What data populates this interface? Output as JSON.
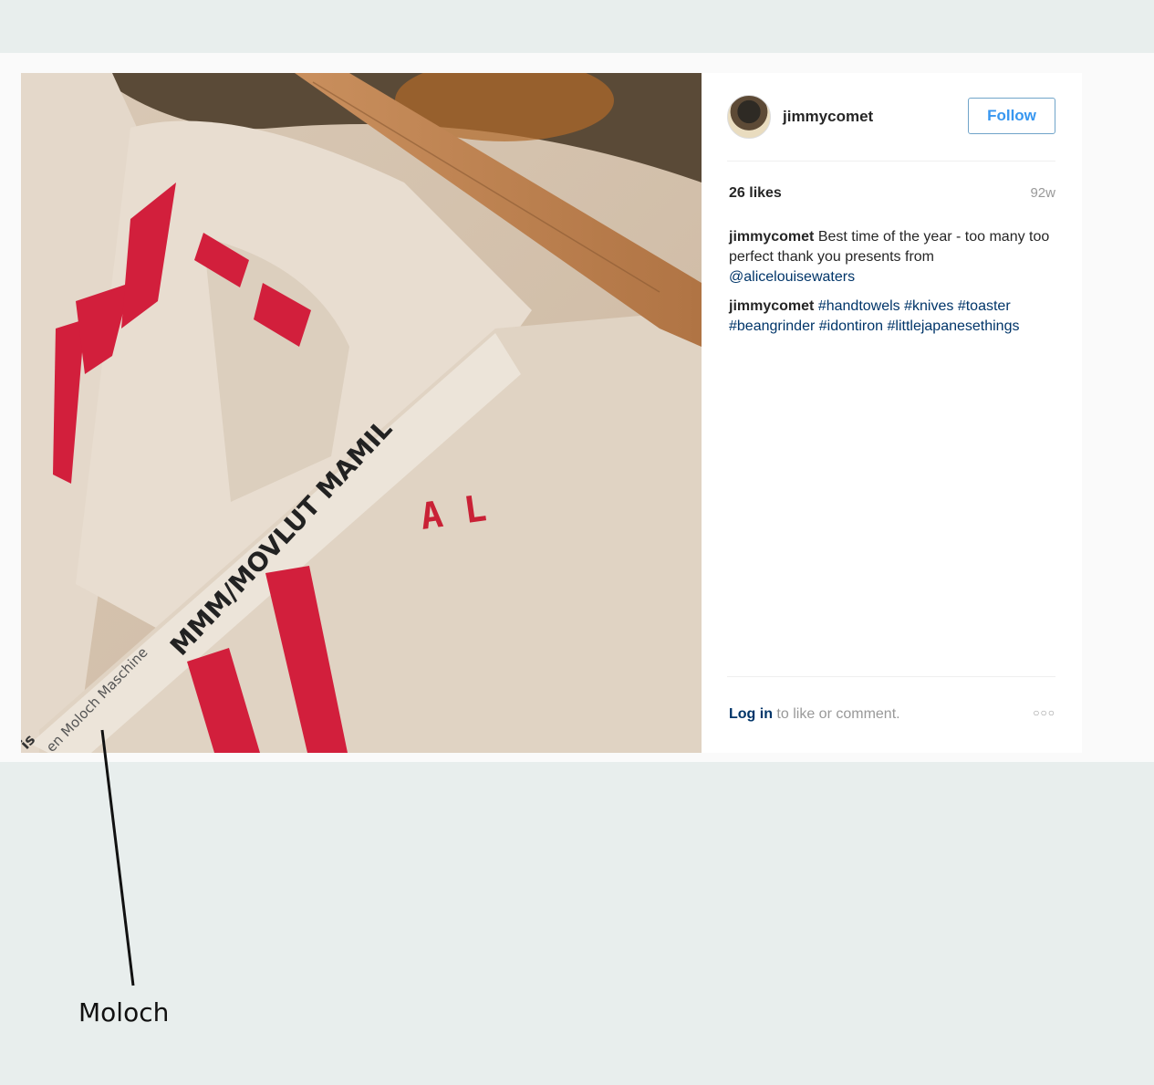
{
  "post": {
    "username": "jimmycomet",
    "follow_label": "Follow",
    "likes": "26 likes",
    "age": "92w",
    "comments": [
      {
        "author": "jimmycomet",
        "text": " Best time of the year - too many too perfect thank you presents from ",
        "mention": "@alicelouisewaters"
      },
      {
        "author": "jimmycomet",
        "tags": [
          "#handtowels",
          "#knives",
          "#toaster",
          "#beangrinder",
          "#idontiron",
          "#littlejapanesethings"
        ]
      }
    ],
    "login_link": "Log in",
    "login_rest": " to like or comment.",
    "more_icon": "ellipsis-icon"
  },
  "photo": {
    "description_icon": "photo",
    "tag_text": "en Moloch Maschine",
    "tag_prefix": "is",
    "handwriting": "MMM/MOVLUT MAMIL",
    "monogram": "A L"
  },
  "annotation": {
    "label": "Moloch"
  },
  "colors": {
    "link": "#003569",
    "follow": "#3897f0",
    "towel_red": "#d21f3c"
  }
}
